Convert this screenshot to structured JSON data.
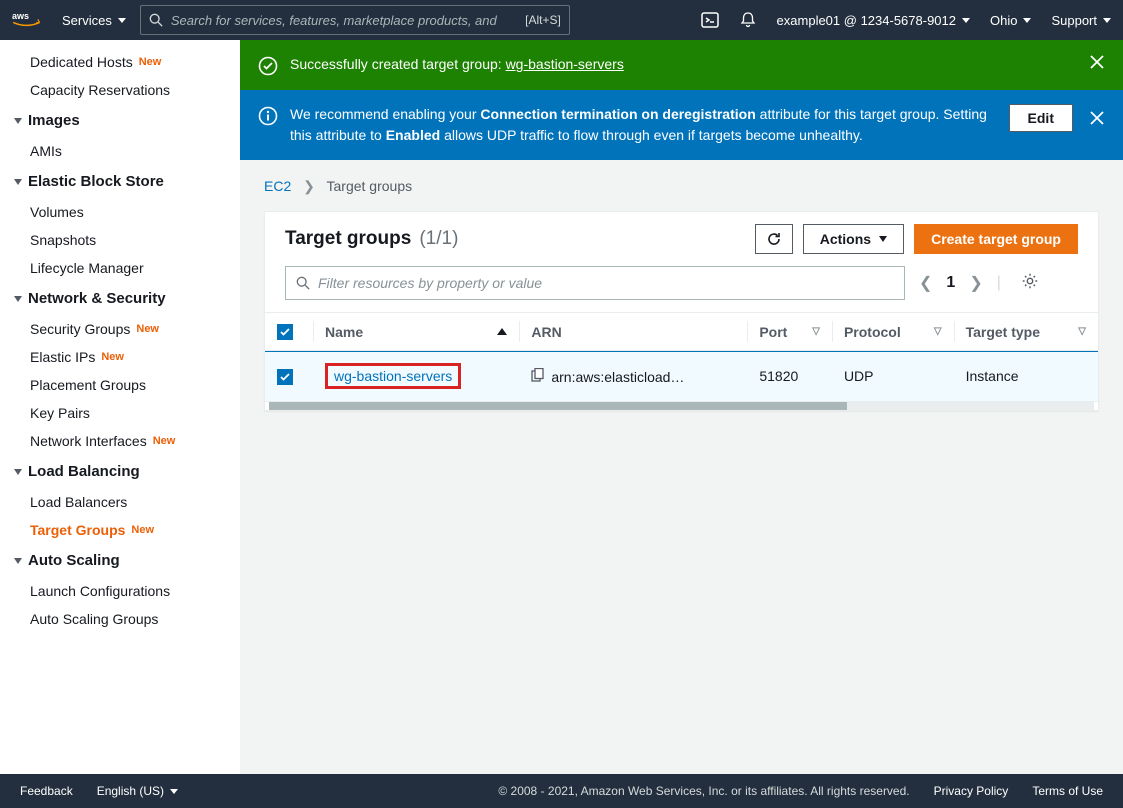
{
  "topbar": {
    "services": "Services",
    "search_placeholder": "Search for services, features, marketplace products, and",
    "search_hint": "[Alt+S]",
    "account": "example01 @ 1234-5678-9012",
    "region": "Ohio",
    "support": "Support"
  },
  "sidebar": {
    "s0": {
      "i0": "Dedicated Hosts",
      "i1": "Capacity Reservations"
    },
    "s1": {
      "title": "Images",
      "i0": "AMIs"
    },
    "s2": {
      "title": "Elastic Block Store",
      "i0": "Volumes",
      "i1": "Snapshots",
      "i2": "Lifecycle Manager"
    },
    "s3": {
      "title": "Network & Security",
      "i0": "Security Groups",
      "i1": "Elastic IPs",
      "i2": "Placement Groups",
      "i3": "Key Pairs",
      "i4": "Network Interfaces"
    },
    "s4": {
      "title": "Load Balancing",
      "i0": "Load Balancers",
      "i1": "Target Groups"
    },
    "s5": {
      "title": "Auto Scaling",
      "i0": "Launch Configurations",
      "i1": "Auto Scaling Groups"
    },
    "new": "New"
  },
  "banner_success": {
    "prefix": "Successfully created target group: ",
    "link": "wg-bastion-servers"
  },
  "banner_info": {
    "t1": "We recommend enabling your ",
    "b1": "Connection termination on deregistration",
    "t2": " attribute for this target group. Setting this attribute to ",
    "b2": "Enabled",
    "t3": " allows UDP traffic to flow through even if targets become unhealthy.",
    "edit": "Edit"
  },
  "breadcrumb": {
    "root": "EC2",
    "current": "Target groups"
  },
  "panel": {
    "title": "Target groups",
    "count": "(1/1)",
    "actions": "Actions",
    "create": "Create target group",
    "filter_placeholder": "Filter resources by property or value",
    "page": "1"
  },
  "columns": {
    "c0": "Name",
    "c1": "ARN",
    "c2": "Port",
    "c3": "Protocol",
    "c4": "Target type"
  },
  "row": {
    "name": "wg-bastion-servers",
    "arn": "arn:aws:elasticload…",
    "port": "51820",
    "protocol": "UDP",
    "ttype": "Instance"
  },
  "footer": {
    "feedback": "Feedback",
    "lang": "English (US)",
    "copy": "© 2008 - 2021, Amazon Web Services, Inc. or its affiliates. All rights reserved.",
    "privacy": "Privacy Policy",
    "terms": "Terms of Use"
  }
}
